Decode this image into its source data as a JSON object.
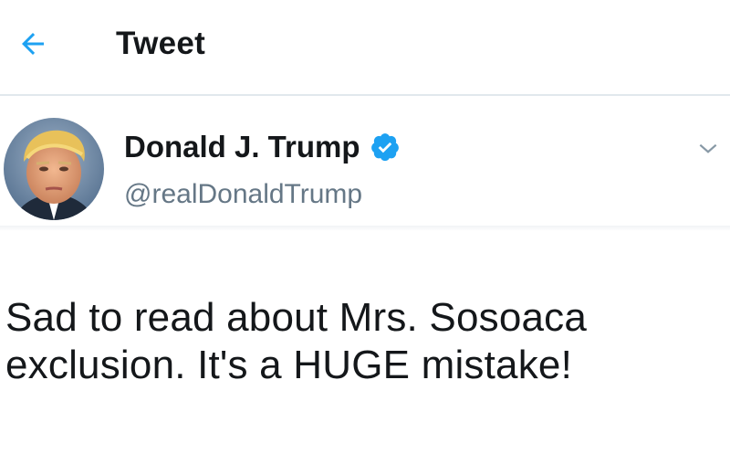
{
  "header": {
    "title": "Tweet",
    "back_icon": "arrow-left-icon",
    "accent": "#1da1f2"
  },
  "author": {
    "name": "Donald J. Trump",
    "handle": "@realDonaldTrump",
    "verified": true,
    "verified_icon": "verified-badge-icon",
    "avatar_icon": "avatar",
    "menu_icon": "chevron-down-icon"
  },
  "tweet": {
    "lines": [
      "Sad to read about Mrs. Sosoaca",
      "exclusion. It's a HUGE mistake!"
    ]
  },
  "colors": {
    "text": "#14171a",
    "secondary_text": "#657786",
    "border": "#e1e8ed",
    "accent": "#1da1f2"
  }
}
